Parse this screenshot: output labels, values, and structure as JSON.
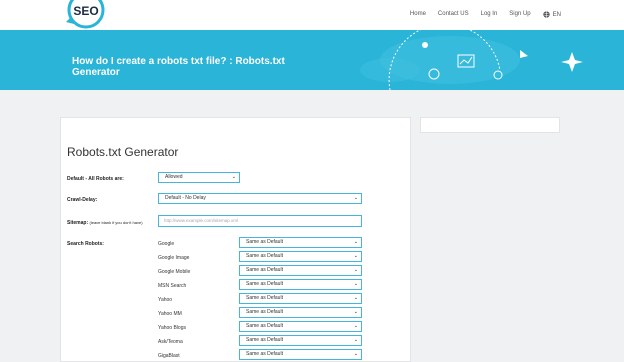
{
  "brand": {
    "logo_text": "SEO"
  },
  "nav": {
    "items": [
      {
        "label": "Home"
      },
      {
        "label": "Contact US"
      },
      {
        "label": "Log In"
      },
      {
        "label": "Sign Up"
      }
    ],
    "lang": "EN"
  },
  "hero": {
    "title": "How do I create a robots txt file? : Robots.txt Generator"
  },
  "colors": {
    "accent": "#29b4d8",
    "input_border": "#45b6d9"
  },
  "form": {
    "title": "Robots.txt Generator",
    "default_label": "Default - All Robots are:",
    "default_value": "Allowed",
    "crawl_label": "Crawl-Delay:",
    "crawl_value": "Default - No Delay",
    "sitemap_label": "Sitemap:",
    "sitemap_note": "(leave blank if you don't have)",
    "sitemap_placeholder": "http://www.example.com/sitemap.xml",
    "search_label": "Search Robots:",
    "robots": [
      {
        "name": "Google",
        "value": "Same as Default"
      },
      {
        "name": "Google Image",
        "value": "Same as Default"
      },
      {
        "name": "Google Mobile",
        "value": "Same as Default"
      },
      {
        "name": "MSN Search",
        "value": "Same as Default"
      },
      {
        "name": "Yahoo",
        "value": "Same as Default"
      },
      {
        "name": "Yahoo MM",
        "value": "Same as Default"
      },
      {
        "name": "Yahoo Blogs",
        "value": "Same as Default"
      },
      {
        "name": "Ask/Teoma",
        "value": "Same as Default"
      },
      {
        "name": "GigaBlast",
        "value": "Same as Default"
      }
    ]
  }
}
